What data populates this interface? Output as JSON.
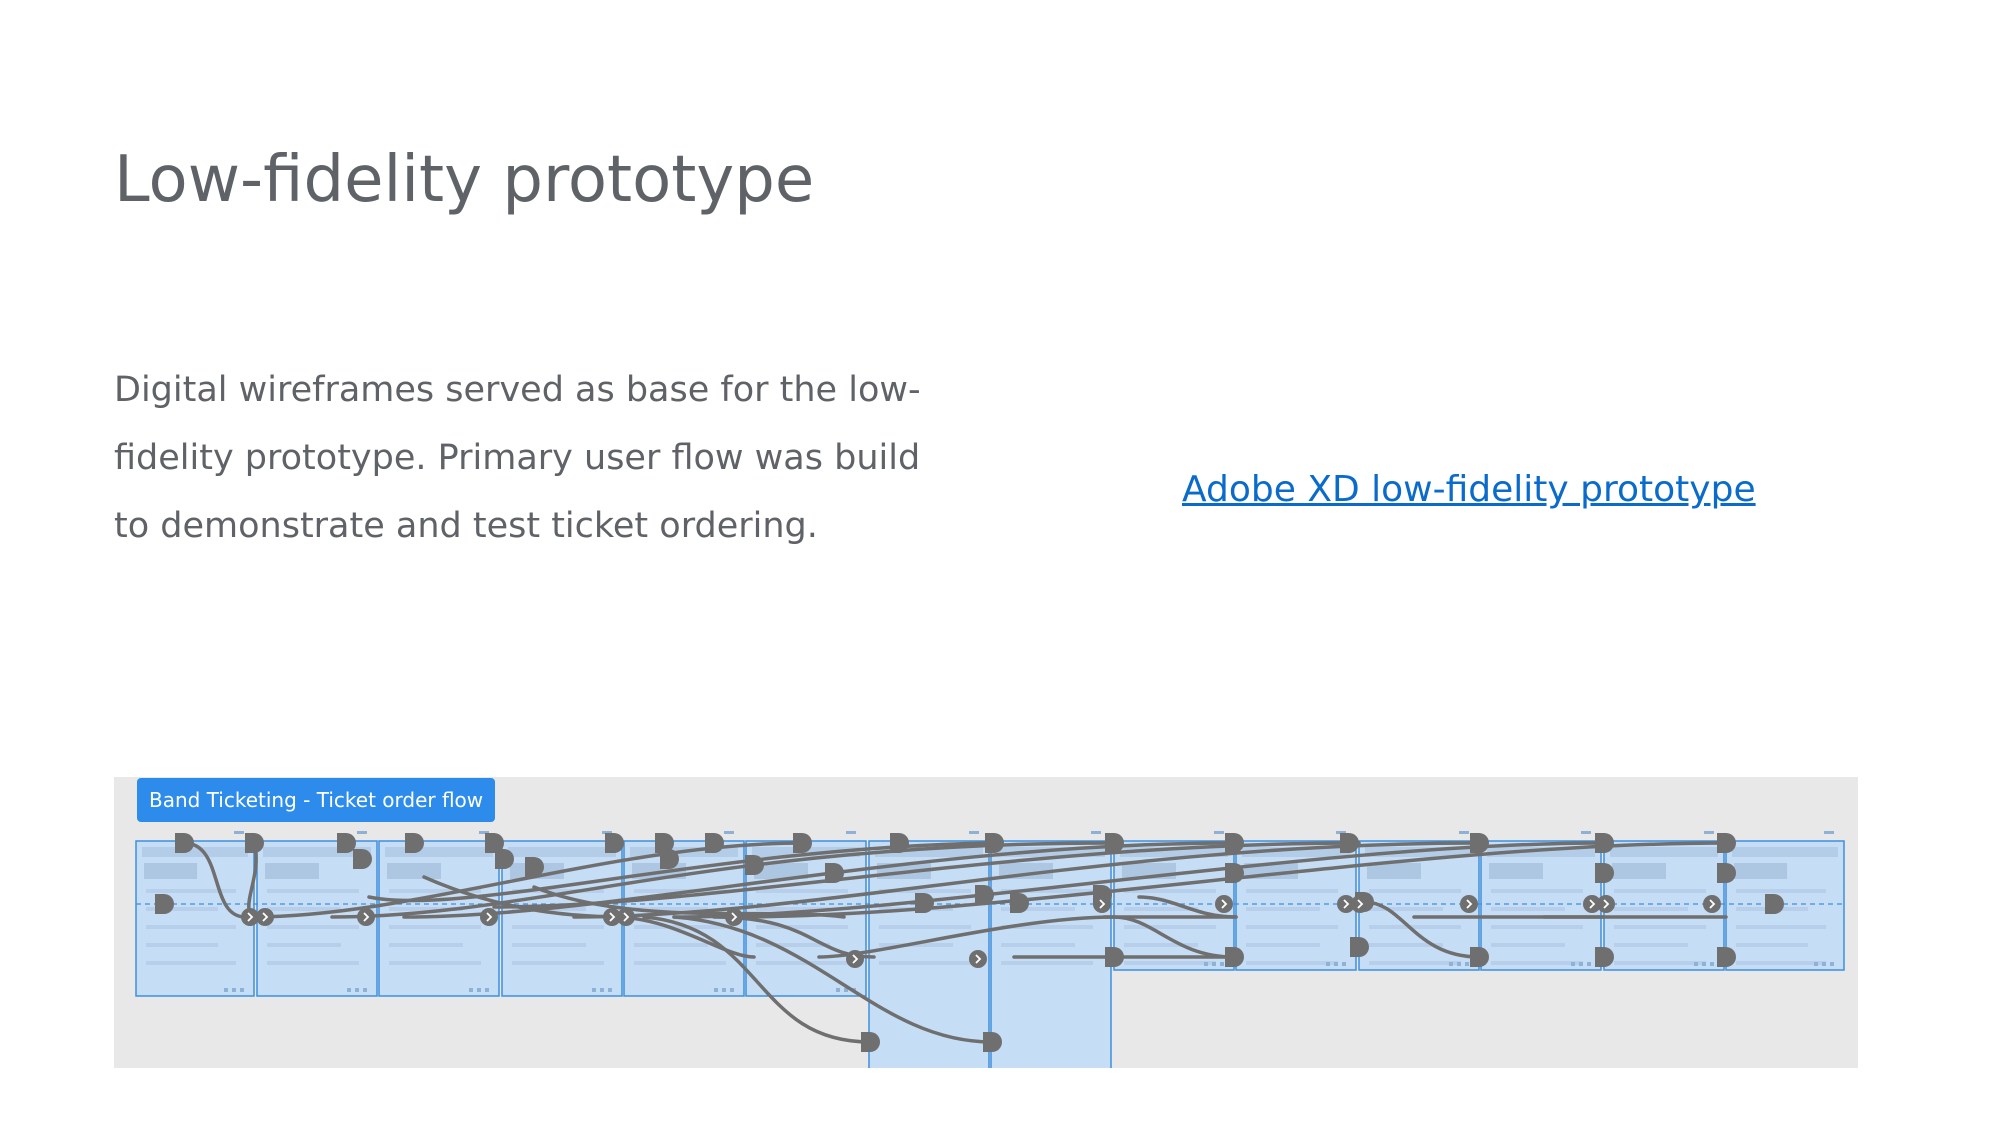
{
  "page": {
    "title": "Low-fidelity prototype",
    "description": "Digital wireframes served as base for the low-fidelity prototype. Primary user flow was build to demonstrate and test ticket ordering.",
    "link_label": "Adobe XD low-fidelity prototype"
  },
  "prototype_canvas": {
    "flow_name": "Band Ticketing - Ticket order flow",
    "artboard_count": 14,
    "colors": {
      "canvas_background": "#e8e8e8",
      "artboard_fill": "#c6ddf6",
      "artboard_border": "#3d8fe0",
      "wire": "#6f6f6f",
      "flow_label": "#2d8ceb",
      "link": "#0b6bcb"
    },
    "icons": [
      "connector-handle-icon",
      "transition-arrow-icon"
    ]
  }
}
